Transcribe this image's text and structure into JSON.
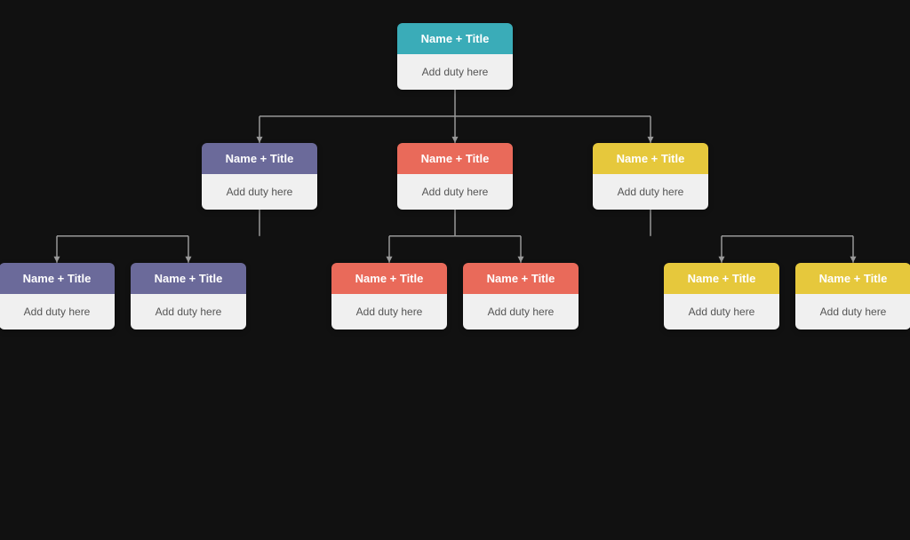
{
  "colors": {
    "teal": "#3aacb8",
    "purple": "#6b6a9a",
    "coral": "#e96a5a",
    "yellow": "#e6c83c",
    "cardBg": "#f0f0f0",
    "line": "#999999"
  },
  "root": {
    "header": "Name + Title",
    "body": "Add duty here",
    "color": "teal"
  },
  "level1": [
    {
      "id": "l1-0",
      "header": "Name + Title",
      "body": "Add duty here",
      "color": "purple"
    },
    {
      "id": "l1-1",
      "header": "Name + Title",
      "body": "Add duty here",
      "color": "coral"
    },
    {
      "id": "l1-2",
      "header": "Name + Title",
      "body": "Add duty here",
      "color": "yellow"
    }
  ],
  "level2": [
    [
      {
        "id": "l2-0",
        "header": "Name + Title",
        "body": "Add duty here",
        "color": "purple"
      },
      {
        "id": "l2-1",
        "header": "Name + Title",
        "body": "Add duty here",
        "color": "purple"
      }
    ],
    [
      {
        "id": "l2-2",
        "header": "Name + Title",
        "body": "Add duty here",
        "color": "coral"
      },
      {
        "id": "l2-3",
        "header": "Name + Title",
        "body": "Add duty here",
        "color": "coral"
      }
    ],
    [
      {
        "id": "l2-4",
        "header": "Name + Title",
        "body": "Add duty here",
        "color": "yellow"
      },
      {
        "id": "l2-5",
        "header": "Name + Title",
        "body": "Add duty here",
        "color": "yellow"
      }
    ]
  ]
}
